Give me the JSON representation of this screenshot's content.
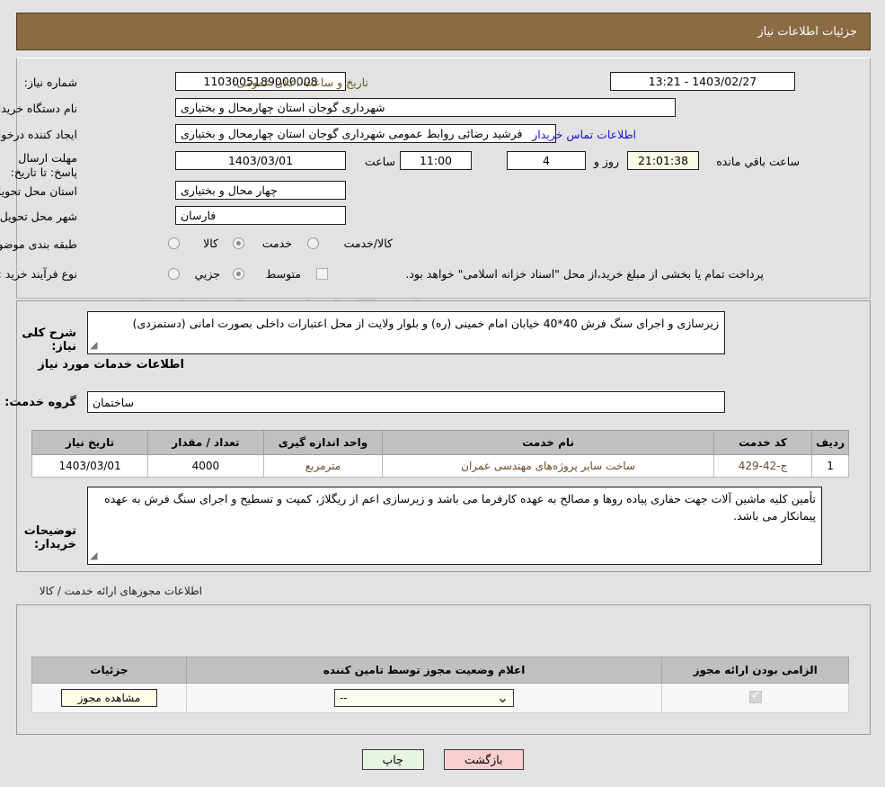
{
  "header": {
    "title": "جزئیات اطلاعات نیاز"
  },
  "form": {
    "need_number_label": "شماره نیاز:",
    "need_number_value": "1103005189000008",
    "announce_label": "تاریخ و ساعت اعلان عمومی:",
    "announce_value": "13:21 - 1403/02/27",
    "buyer_org_label": "نام دستگاه خریدار:",
    "buyer_org_value": "شهرداری گوجان استان چهارمحال و بختیاری",
    "creator_label": "ایجاد کننده درخواست:",
    "creator_value": "فرشید رضائی روابط عمومی شهرداری گوجان استان چهارمحال و بختیاری",
    "contact_link": "اطلاعات تماس خریدار",
    "deadline_label": "مهلت ارسال پاسخ: تا تاریخ:",
    "deadline_date": "1403/03/01",
    "time_label": "ساعت",
    "time_value": "11:00",
    "days_value": "4",
    "days_label": "روز و",
    "countdown_value": "21:01:38",
    "countdown_label": "ساعت باقي مانده",
    "province_label": "استان محل تحویل:",
    "province_value": "چهار محال و بختیاری",
    "city_label": "شهر محل تحویل:",
    "city_value": "فارسان",
    "category_label": "طبقه بندی موضوعی:",
    "category_options": [
      {
        "label": "کالا",
        "selected": false
      },
      {
        "label": "خدمت",
        "selected": true
      },
      {
        "label": "کالا/خدمت",
        "selected": false
      }
    ],
    "process_label": "نوع فرآیند خرید :",
    "process_options": [
      {
        "label": "جزیي",
        "selected": false
      },
      {
        "label": "متوسط",
        "selected": true
      }
    ],
    "treasury_checkbox_label": "پرداخت تمام یا بخشی از مبلغ خرید،از محل \"اسناد خزانه اسلامی\" خواهد بود.",
    "treasury_checked": false
  },
  "description": {
    "label": "شرح کلی نیاز:",
    "value": "زیرسازی و اجرای سنگ فرش 40*40 خیابان امام خمینی (ره) و بلوار ولایت از محل اعتبارات داخلی بصورت امانی (دستمزدی)"
  },
  "services": {
    "section_title": "اطلاعات خدمات مورد نیاز",
    "group_label": "گروه خدمت:",
    "group_value": "ساختمان",
    "columns": [
      "ردیف",
      "کد خدمت",
      "نام خدمت",
      "واحد اندازه گیری",
      "تعداد / مقدار",
      "تاریخ نیاز"
    ],
    "rows": [
      {
        "row": "1",
        "code": "ج-42-429",
        "name": "ساخت سایر پروژه‌های مهندسی عمران",
        "unit": "مترمربع",
        "qty": "4000",
        "date": "1403/03/01"
      }
    ]
  },
  "buyer_notes": {
    "label": "توضیحات خریدار:",
    "value": "تأمین کلیه ماشین آلات جهت حفاری پیاده روها و مصالح به عهده کارفرما می باشد و زیرسازی اعم از ریگلاژ، کمپت و تسطیح و اجرای سنگ فرش به عهده پیمانکار می باشد."
  },
  "permits": {
    "section_title": "اطلاعات مجوزهای ارائه خدمت / کالا",
    "columns": [
      "الزامی بودن ارائه مجوز",
      "اعلام وضعیت مجوز توسط تامین کننده",
      "جزئیات"
    ],
    "rows": [
      {
        "required_checked": true,
        "status_value": "--",
        "detail_button": "مشاهده مجوز"
      }
    ]
  },
  "footer": {
    "print_label": "چاپ",
    "back_label": "بازگشت"
  },
  "watermark": {
    "main": "AriaTender.net",
    "top": "AriaTender.net"
  },
  "colors": {
    "header_bg": "#8b6b43",
    "page_bg": "#e2e2e2",
    "link": "#1414d8",
    "olive_label": "#6b5a2a",
    "table_header": "#c0c0c0",
    "table_text": "#6b4a23",
    "print_btn": "#e6f5e2",
    "back_btn": "#fbcfcf"
  }
}
